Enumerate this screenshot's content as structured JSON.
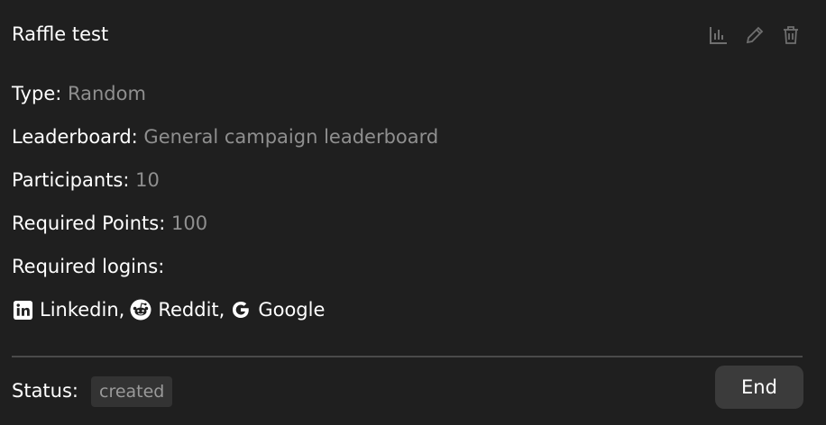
{
  "title": "Raffle test",
  "actions": {
    "stats_icon": "bar-chart-icon",
    "edit_icon": "pencil-icon",
    "delete_icon": "trash-icon",
    "icon_color": "#6f6f6f"
  },
  "fields": {
    "type": {
      "label": "Type:",
      "value": "Random"
    },
    "leaderboard": {
      "label": "Leaderboard:",
      "value": "General campaign leaderboard"
    },
    "participants": {
      "label": "Participants:",
      "value": "10"
    },
    "required_points": {
      "label": "Required Points:",
      "value": "100"
    },
    "required_logins": {
      "label": "Required logins:"
    }
  },
  "logins": [
    {
      "name": "Linkedin",
      "icon": "linkedin-icon",
      "suffix": ","
    },
    {
      "name": "Reddit",
      "icon": "reddit-icon",
      "suffix": ","
    },
    {
      "name": "Google",
      "icon": "google-icon",
      "suffix": ""
    }
  ],
  "status": {
    "label": "Status:",
    "value": "created"
  },
  "end_button": {
    "label": "End"
  },
  "colors": {
    "background": "#1f1f1f",
    "value_text": "#8f8f8f",
    "badge_bg": "#333333",
    "button_bg": "#3b3b3b"
  }
}
